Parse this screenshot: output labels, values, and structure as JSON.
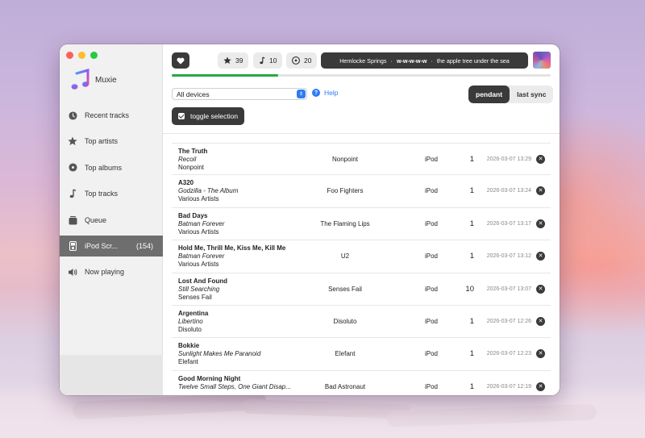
{
  "app": {
    "name": "Muxie",
    "accent_color": "#28a745",
    "link_color": "#2f7bf5"
  },
  "sidebar": {
    "items": [
      {
        "icon": "clock-icon",
        "label": "Recent tracks",
        "active": false
      },
      {
        "icon": "star-icon",
        "label": "Top artists",
        "active": false
      },
      {
        "icon": "disc-icon",
        "label": "Top albums",
        "active": false
      },
      {
        "icon": "music-note-icon",
        "label": "Top tracks",
        "active": false
      },
      {
        "icon": "queue-icon",
        "label": "Queue",
        "active": false
      },
      {
        "icon": "ipod-icon",
        "label": "iPod Scr...",
        "count": "(154)",
        "active": true
      },
      {
        "icon": "speaker-icon",
        "label": "Now playing",
        "active": false
      }
    ]
  },
  "toolbar": {
    "stars": "39",
    "tracks": "10",
    "albums": "20",
    "now_playing": {
      "artist": "Hemlocke Springs",
      "sep1": "·",
      "title": "w-w-w-w-w",
      "sep2": "·",
      "album": "the apple tree under the sea"
    },
    "progress_fraction": 0.28
  },
  "filters": {
    "device_select": "All devices",
    "help_label": "Help",
    "segment": {
      "pendant": "pendant",
      "last_sync": "last sync",
      "selected": "pendant"
    },
    "toggle_selection": "toggle selection"
  },
  "rows": [
    {
      "title": "The Truth",
      "album": "Recoil",
      "album_artist": "Nonpoint",
      "artist": "Nonpoint",
      "device": "iPod",
      "count": "1",
      "date": "2026-03-07 13:29"
    },
    {
      "title": "A320",
      "album": "Godzilla - The Album",
      "album_artist": "Various Artists",
      "artist": "Foo Fighters",
      "device": "iPod",
      "count": "1",
      "date": "2026-03-07 13:24"
    },
    {
      "title": "Bad Days",
      "album": "Batman Forever",
      "album_artist": "Various Artists",
      "artist": "The Flaming Lips",
      "device": "iPod",
      "count": "1",
      "date": "2026-03-07 13:17"
    },
    {
      "title": "Hold Me, Thrill Me, Kiss Me, Kill Me",
      "album": "Batman Forever",
      "album_artist": "Various Artists",
      "artist": "U2",
      "device": "iPod",
      "count": "1",
      "date": "2026-03-07 13:12"
    },
    {
      "title": "Lost And Found",
      "album": "Still Searching",
      "album_artist": "Senses Fail",
      "artist": "Senses Fail",
      "device": "iPod",
      "count": "10",
      "date": "2026-03-07 13:07"
    },
    {
      "title": "Argentina",
      "album": "Libertino",
      "album_artist": "Disoluto",
      "artist": "Disoluto",
      "device": "iPod",
      "count": "1",
      "date": "2026-03-07 12:26"
    },
    {
      "title": "Bokkie",
      "album": "Sunlight Makes Me Paranoid",
      "album_artist": "Elefant",
      "artist": "Elefant",
      "device": "iPod",
      "count": "1",
      "date": "2026-03-07 12:23"
    },
    {
      "title": "Good Morning Night",
      "album": "Twelve Small Steps, One Giant Disap...",
      "album_artist": "",
      "artist": "Bad Astronaut",
      "device": "iPod",
      "count": "1",
      "date": "2026-03-07 12:19"
    }
  ]
}
